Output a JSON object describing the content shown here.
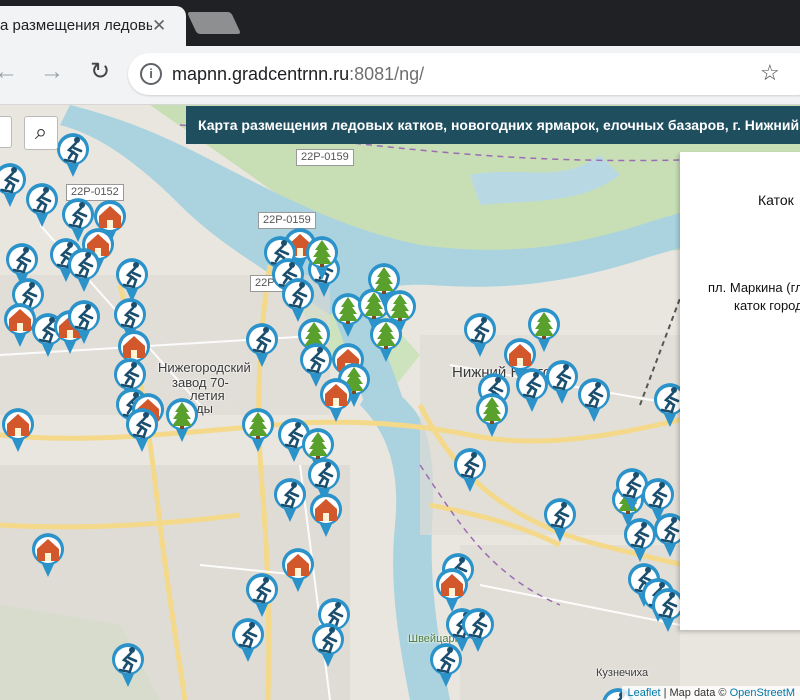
{
  "browser": {
    "tab_title": "а размещения ледовых",
    "tab_close": "✕",
    "url_host": "mapnn.gradcentrnn.ru",
    "url_rest": ":8081/ng/",
    "back_glyph": "←",
    "forward_glyph": "→",
    "reload_glyph": "↻",
    "info_glyph": "i",
    "star_glyph": "☆"
  },
  "map": {
    "banner": "Карта размещения ледовых катков, новогодних ярмарок, елочных базаров, г. Нижний",
    "search_glyph": "⌕",
    "road_labels": [
      "22P-0159",
      "22P-0152",
      "22P-0159",
      "22P-015"
    ],
    "place_labels": [
      "Нижегородский",
      "завод 70-",
      "летия",
      "ды",
      "Нижний Новгород",
      "Швейцария",
      "Кузнечиха"
    ],
    "popup": {
      "title": "Каток",
      "line1": "пл. Маркина (гл",
      "line2": "каток город"
    },
    "attribution": {
      "leaflet": "Leaflet",
      "sep": " | Map data © ",
      "osm": "OpenStreetM"
    },
    "marker_types": {
      "skate": "skating-icon",
      "tree": "christmas-tree-icon",
      "fair": "fair-house-icon"
    },
    "colors": {
      "marker_ring": "#2b93c9",
      "banner": "#1f4e5f",
      "tree": "#5aa02c",
      "house": "#d2572a"
    }
  }
}
